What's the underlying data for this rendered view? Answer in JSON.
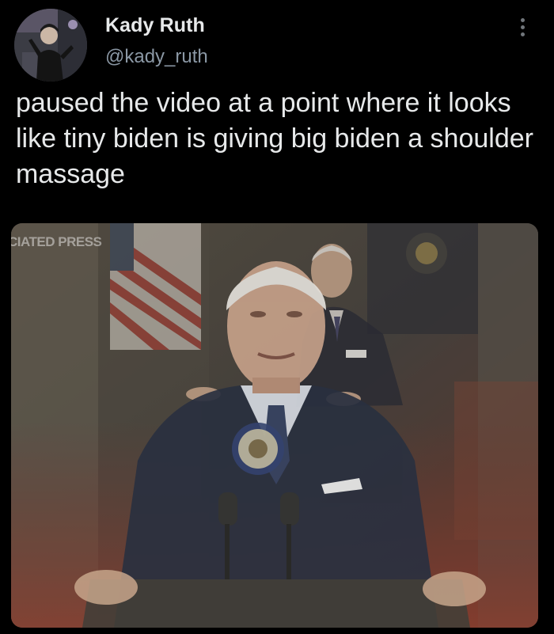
{
  "tweet": {
    "display_name": "Kady Ruth",
    "handle": "@kady_ruth",
    "text": "paused the video at a point where it looks like tiny biden is giving big biden a shoulder massage",
    "more_icon": "more-vertical-icon"
  },
  "media": {
    "watermark": "CIATED PRESS"
  },
  "colors": {
    "background": "#000000",
    "primary_text": "#e7e9ea",
    "secondary_text": "#8b98a5"
  }
}
